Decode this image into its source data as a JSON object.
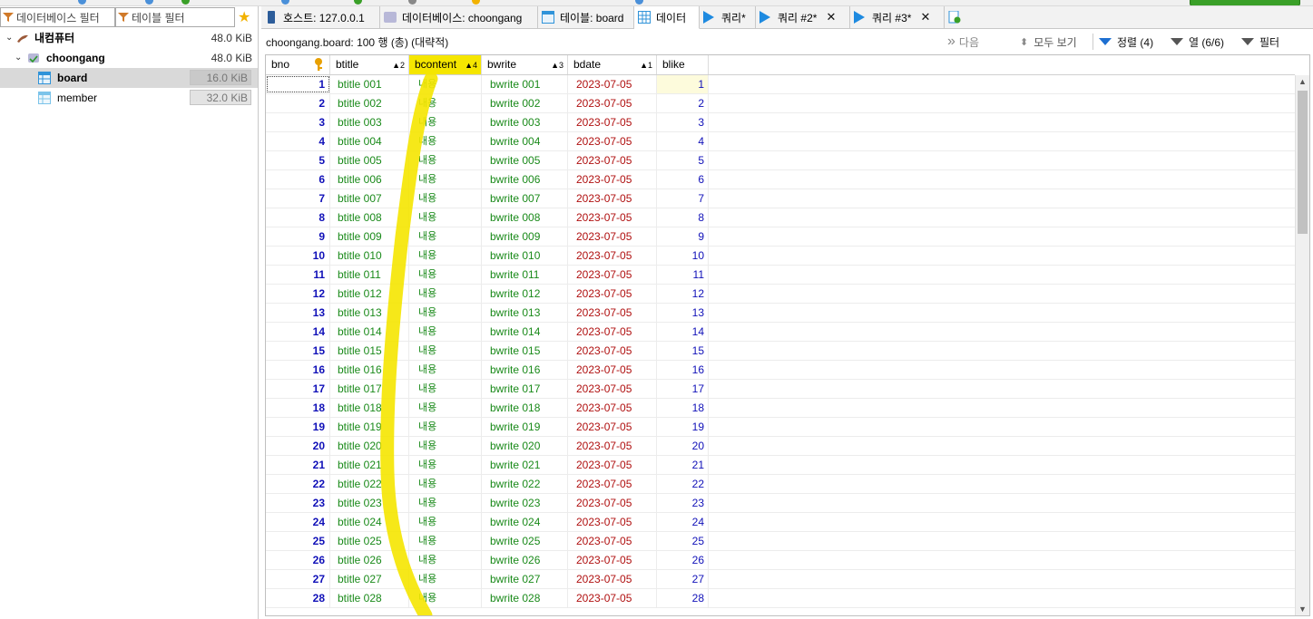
{
  "left_panel": {
    "db_filter_placeholder": "데이터베이스 필터",
    "table_filter_placeholder": "테이블 필터",
    "tree": [
      {
        "label": "내컴퓨터",
        "size": "48.0 KiB"
      },
      {
        "label": "choongang",
        "size": "48.0 KiB"
      },
      {
        "label": "board",
        "size": "16.0 KiB"
      },
      {
        "label": "member",
        "size": "32.0 KiB"
      }
    ]
  },
  "tabs": [
    {
      "label": "호스트: 127.0.0.1"
    },
    {
      "label": "데이터베이스: choongang"
    },
    {
      "label": "테이블: board"
    },
    {
      "label": "데이터"
    },
    {
      "label": "쿼리*"
    },
    {
      "label": "쿼리 #2*"
    },
    {
      "label": "쿼리 #3*"
    }
  ],
  "data_view": {
    "info": "choongang.board: 100 행 (총) (대략적)",
    "next_label": "다음",
    "show_all_label": "모두 보기",
    "sort_label": "정렬 (4)",
    "columns_label": "열 (6/6)",
    "filter_label": "필터"
  },
  "columns": [
    {
      "name": "bno",
      "sort": ""
    },
    {
      "name": "btitle",
      "sort": "▲2"
    },
    {
      "name": "bcontent",
      "sort": "▲4"
    },
    {
      "name": "bwrite",
      "sort": "▲3"
    },
    {
      "name": "bdate",
      "sort": "▲1"
    },
    {
      "name": "blike",
      "sort": ""
    }
  ],
  "rows": [
    [
      "1",
      "btitle 001",
      "내용",
      "bwrite 001",
      "2023-07-05",
      "1"
    ],
    [
      "2",
      "btitle 002",
      "내용",
      "bwrite 002",
      "2023-07-05",
      "2"
    ],
    [
      "3",
      "btitle 003",
      "내용",
      "bwrite 003",
      "2023-07-05",
      "3"
    ],
    [
      "4",
      "btitle 004",
      "내용",
      "bwrite 004",
      "2023-07-05",
      "4"
    ],
    [
      "5",
      "btitle 005",
      "내용",
      "bwrite 005",
      "2023-07-05",
      "5"
    ],
    [
      "6",
      "btitle 006",
      "내용",
      "bwrite 006",
      "2023-07-05",
      "6"
    ],
    [
      "7",
      "btitle 007",
      "내용",
      "bwrite 007",
      "2023-07-05",
      "7"
    ],
    [
      "8",
      "btitle 008",
      "내용",
      "bwrite 008",
      "2023-07-05",
      "8"
    ],
    [
      "9",
      "btitle 009",
      "내용",
      "bwrite 009",
      "2023-07-05",
      "9"
    ],
    [
      "10",
      "btitle 010",
      "내용",
      "bwrite 010",
      "2023-07-05",
      "10"
    ],
    [
      "11",
      "btitle 011",
      "내용",
      "bwrite 011",
      "2023-07-05",
      "11"
    ],
    [
      "12",
      "btitle 012",
      "내용",
      "bwrite 012",
      "2023-07-05",
      "12"
    ],
    [
      "13",
      "btitle 013",
      "내용",
      "bwrite 013",
      "2023-07-05",
      "13"
    ],
    [
      "14",
      "btitle 014",
      "내용",
      "bwrite 014",
      "2023-07-05",
      "14"
    ],
    [
      "15",
      "btitle 015",
      "내용",
      "bwrite 015",
      "2023-07-05",
      "15"
    ],
    [
      "16",
      "btitle 016",
      "내용",
      "bwrite 016",
      "2023-07-05",
      "16"
    ],
    [
      "17",
      "btitle 017",
      "내용",
      "bwrite 017",
      "2023-07-05",
      "17"
    ],
    [
      "18",
      "btitle 018",
      "내용",
      "bwrite 018",
      "2023-07-05",
      "18"
    ],
    [
      "19",
      "btitle 019",
      "내용",
      "bwrite 019",
      "2023-07-05",
      "19"
    ],
    [
      "20",
      "btitle 020",
      "내용",
      "bwrite 020",
      "2023-07-05",
      "20"
    ],
    [
      "21",
      "btitle 021",
      "내용",
      "bwrite 021",
      "2023-07-05",
      "21"
    ],
    [
      "22",
      "btitle 022",
      "내용",
      "bwrite 022",
      "2023-07-05",
      "22"
    ],
    [
      "23",
      "btitle 023",
      "내용",
      "bwrite 023",
      "2023-07-05",
      "23"
    ],
    [
      "24",
      "btitle 024",
      "내용",
      "bwrite 024",
      "2023-07-05",
      "24"
    ],
    [
      "25",
      "btitle 025",
      "내용",
      "bwrite 025",
      "2023-07-05",
      "25"
    ],
    [
      "26",
      "btitle 026",
      "내용",
      "bwrite 026",
      "2023-07-05",
      "26"
    ],
    [
      "27",
      "btitle 027",
      "내용",
      "bwrite 027",
      "2023-07-05",
      "27"
    ],
    [
      "28",
      "btitle 028",
      "내용",
      "bwrite 028",
      "2023-07-05",
      "28"
    ]
  ],
  "colors": {
    "highlight": "#f5e600",
    "number": "#1010b8",
    "text": "#1a8a1a",
    "date": "#b01010",
    "accent": "#1e8ae0"
  }
}
